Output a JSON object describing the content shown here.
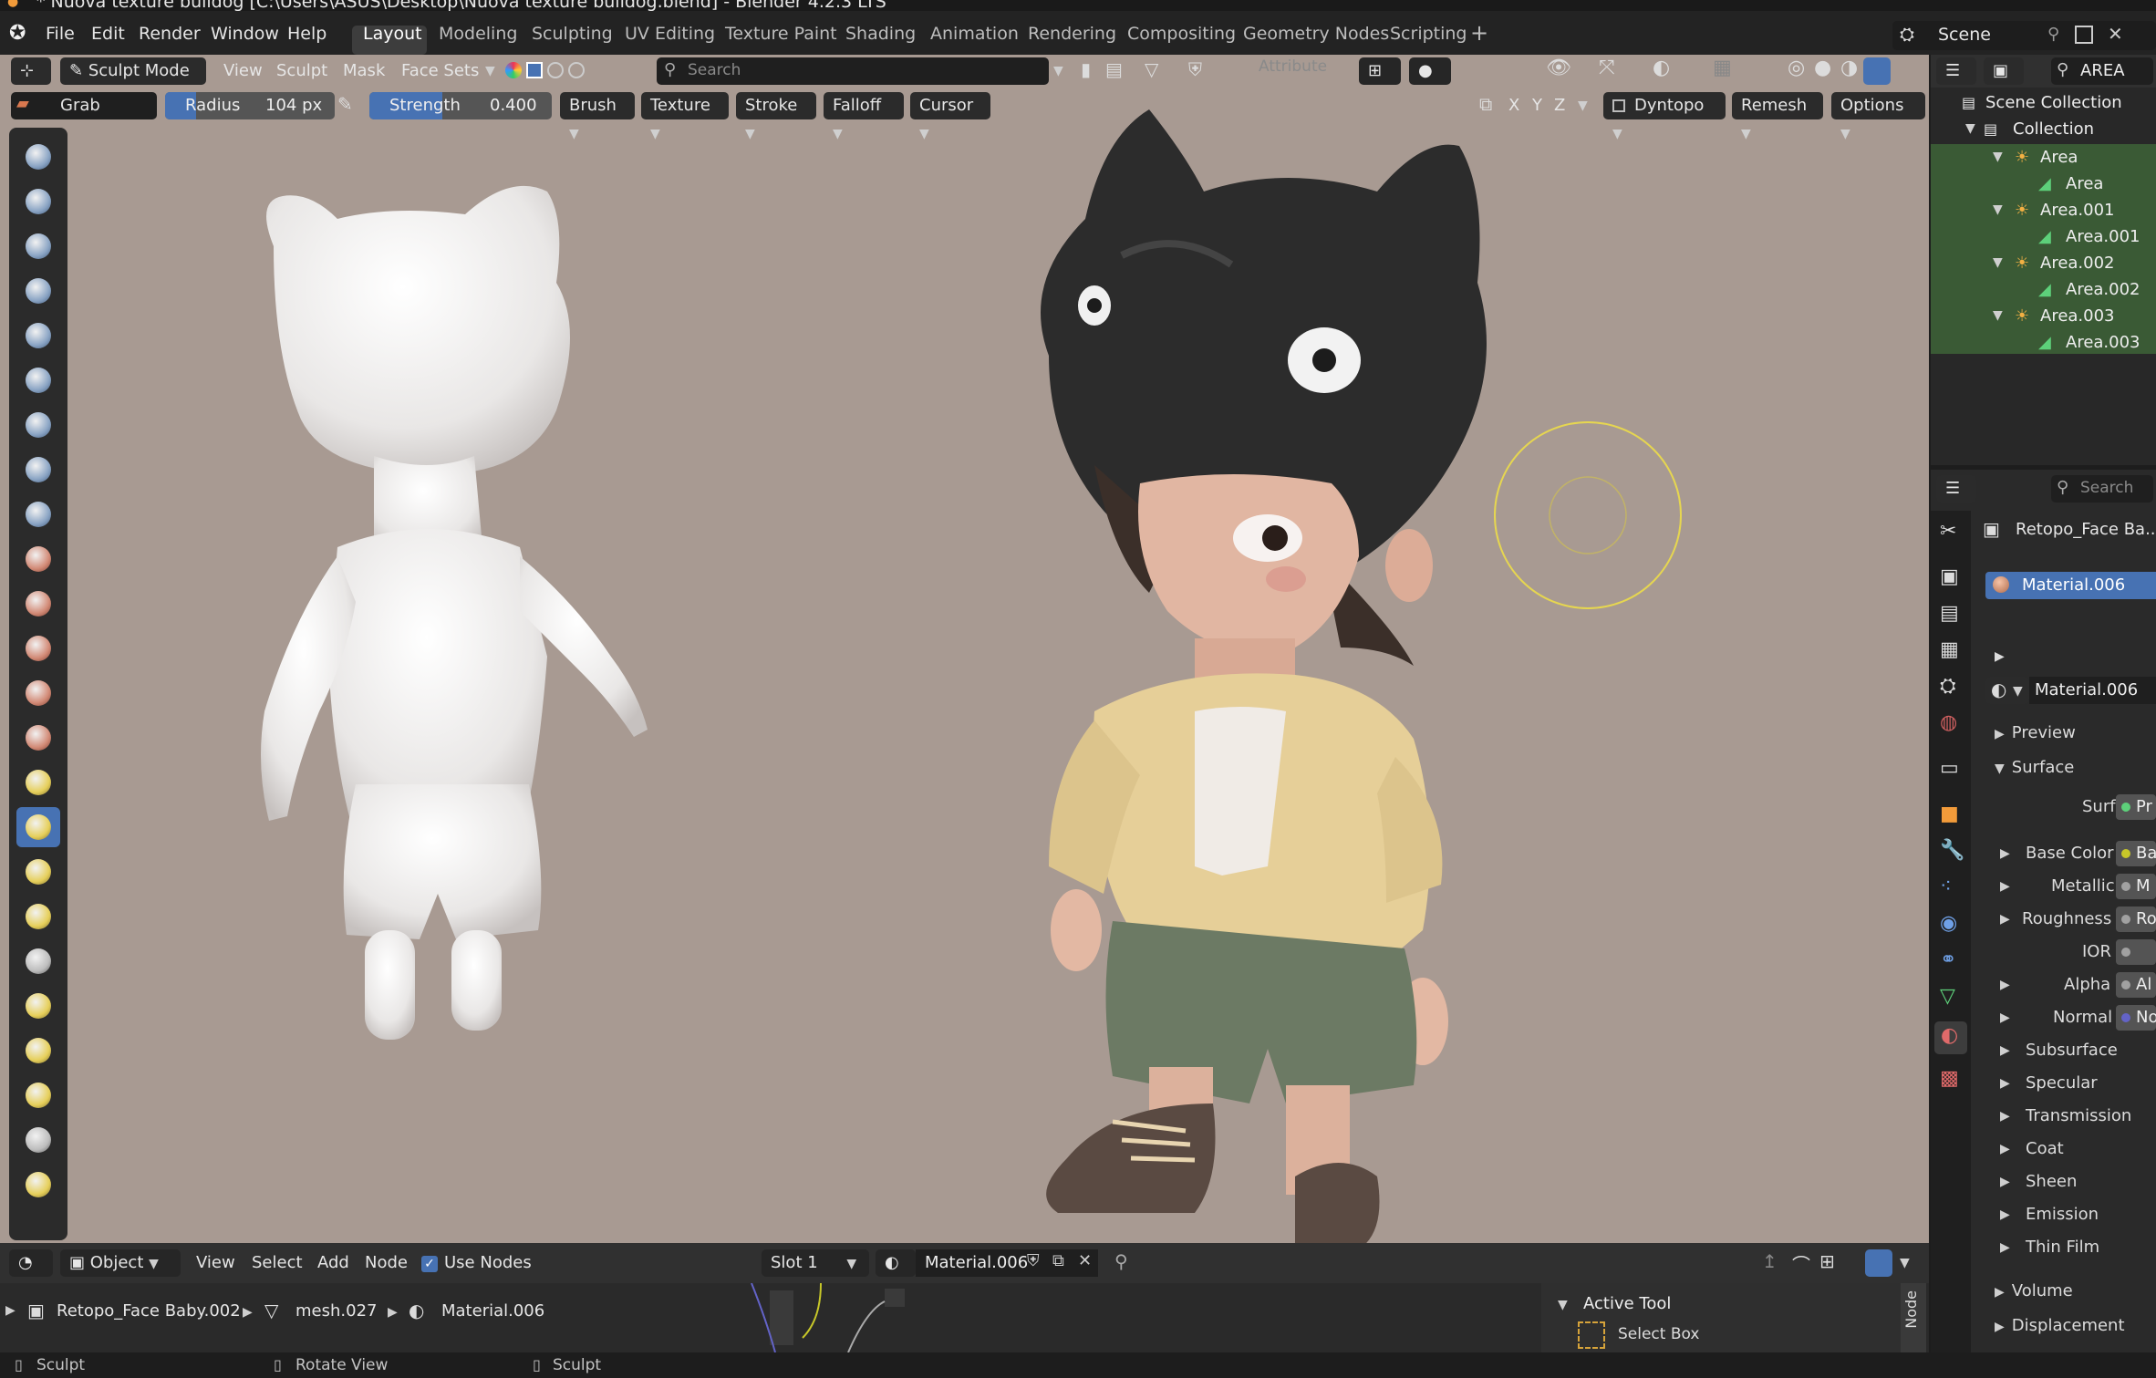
{
  "window": {
    "title": "* Nuova texture bulldog [C:\\Users\\ASUS\\Desktop\\Nuova texture bulldog.blend] - Blender 4.2.3 LTS"
  },
  "menubar": {
    "items": [
      "File",
      "Edit",
      "Render",
      "Window",
      "Help"
    ],
    "workspaces": [
      "Layout",
      "Modeling",
      "Sculpting",
      "UV Editing",
      "Texture Paint",
      "Shading",
      "Animation",
      "Rendering",
      "Compositing",
      "Geometry Nodes",
      "Scripting"
    ],
    "active_workspace": "Layout",
    "scene_label": "Scene"
  },
  "viewport_header": {
    "mode": "Sculpt Mode",
    "menus": [
      "View",
      "Sculpt",
      "Mask",
      "Face Sets"
    ],
    "search_placeholder": "Search",
    "attribute_label": "Attribute"
  },
  "tool_header": {
    "brush_name": "Grab",
    "radius_label": "Radius",
    "radius_value": "104 px",
    "strength_label": "Strength",
    "strength_value": "0.400",
    "dropdowns": [
      "Brush",
      "Texture",
      "Stroke",
      "Falloff",
      "Cursor"
    ],
    "axes": [
      "X",
      "Y",
      "Z"
    ],
    "dyntopo_label": "Dyntopo",
    "remesh_label": "Remesh",
    "options_label": "Options"
  },
  "outliner": {
    "header_label": "AREA",
    "rows": [
      {
        "label": "Scene Collection",
        "indent": 0
      },
      {
        "label": "Collection",
        "indent": 1
      },
      {
        "label": "Area",
        "indent": 2
      },
      {
        "label": "Area",
        "indent": 3
      },
      {
        "label": "Area.001",
        "indent": 2
      },
      {
        "label": "Area.001",
        "indent": 3
      },
      {
        "label": "Area.002",
        "indent": 2
      },
      {
        "label": "Area.002",
        "indent": 3
      },
      {
        "label": "Area.003",
        "indent": 2
      },
      {
        "label": "Area.003",
        "indent": 3
      }
    ]
  },
  "properties": {
    "search_placeholder": "Search",
    "object_name": "Retopo_Face Ba...",
    "material_slot": "Material.006",
    "material_name": "Material.006",
    "panels": {
      "preview": "Preview",
      "surface": "Surface",
      "volume": "Volume",
      "displacement": "Displacement"
    },
    "surface_label": "Surface",
    "surface_value": "Pr",
    "inputs": [
      {
        "label": "Base Color",
        "value": "Ba",
        "socket": "#c7c729"
      },
      {
        "label": "Metallic",
        "value": "M",
        "socket": "#a1a1a1"
      },
      {
        "label": "Roughness",
        "value": "Ro",
        "socket": "#a1a1a1"
      },
      {
        "label": "IOR",
        "value": "",
        "socket": "#a1a1a1"
      },
      {
        "label": "Alpha",
        "value": "Al",
        "socket": "#a1a1a1"
      },
      {
        "label": "Normal",
        "value": "No",
        "socket": "#6363c7"
      }
    ],
    "subpanels": [
      "Subsurface",
      "Specular",
      "Transmission",
      "Coat",
      "Sheen",
      "Emission",
      "Thin Film"
    ]
  },
  "shader_editor": {
    "editor_type": "Object",
    "menus": [
      "View",
      "Select",
      "Add",
      "Node"
    ],
    "use_nodes_label": "Use Nodes",
    "slot": "Slot 1",
    "material": "Material.006",
    "breadcrumb": [
      "Retopo_Face Baby.002",
      "mesh.027",
      "Material.006"
    ],
    "active_tool_label": "Active Tool",
    "select_box_label": "Select Box",
    "side_tab": "Node"
  },
  "statusbar": {
    "items": [
      "Sculpt",
      "Rotate View",
      "Sculpt"
    ]
  },
  "colors": {
    "viewport_bg": "#a89a92",
    "accent": "#4772b3",
    "outliner_highlight": "#3a5a35",
    "brush_circle": "#e6d650"
  }
}
